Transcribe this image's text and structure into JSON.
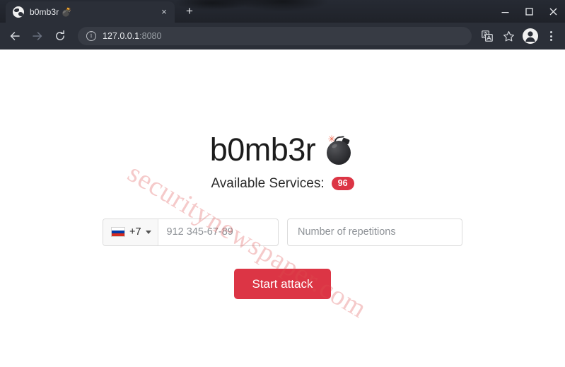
{
  "browser": {
    "tab": {
      "title": "b0mb3r 💣",
      "favicon": "globe-icon",
      "close_label": "×"
    },
    "new_tab_label": "+",
    "window_controls": {
      "minimize": "minimize-icon",
      "maximize": "maximize-icon",
      "close": "close-icon"
    },
    "toolbar": {
      "back": "back-arrow-icon",
      "forward": "forward-arrow-icon",
      "reload": "reload-icon",
      "site_info": "i",
      "url_host": "127.0.0.1",
      "url_port": ":8080",
      "translate": "translate-icon",
      "bookmark": "star-icon",
      "profile": "avatar-icon",
      "menu": "three-dot-menu-icon"
    }
  },
  "page": {
    "watermark": "securitynewspaper.com",
    "title": "b0mb3r",
    "title_emoji": "bomb-emoji",
    "services_label": "Available Services:",
    "services_count": "96",
    "form": {
      "country_dial_code": "+7",
      "country_flag": "russia-flag-icon",
      "phone_placeholder": "912 345-67-89",
      "phone_value": "",
      "repetitions_placeholder": "Number of repetitions",
      "repetitions_value": ""
    },
    "start_button_label": "Start attack"
  },
  "colors": {
    "accent_red": "#dc3545",
    "badge_red": "#dc3545",
    "chrome_dark": "#2b2f38",
    "tabstrip_dark": "#1f2229",
    "watermark": "rgba(222,78,78,0.30)"
  }
}
